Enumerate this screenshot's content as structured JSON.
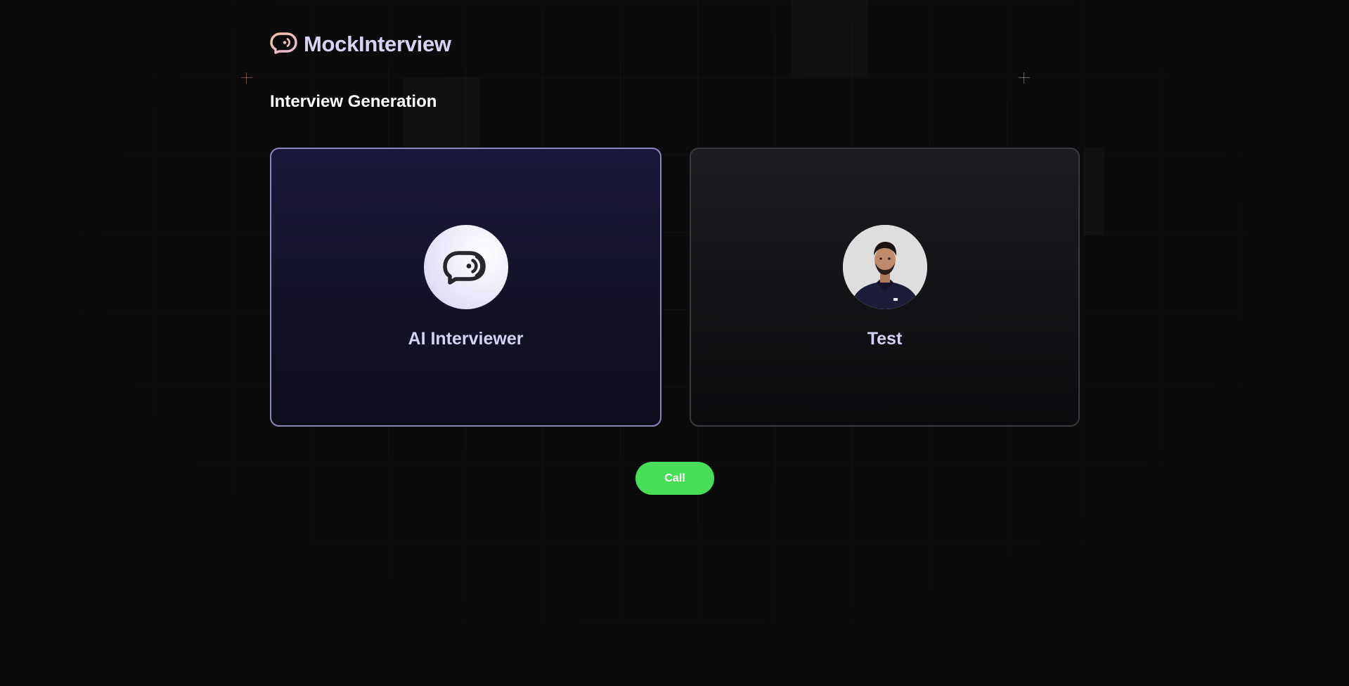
{
  "brand": {
    "name": "MockInterview",
    "icon": "chat-bubble-audio-icon",
    "icon_color": "#f4b99a"
  },
  "page": {
    "title": "Interview Generation"
  },
  "interviewers": [
    {
      "label": "AI Interviewer",
      "avatar": "chat-bubble-audio-icon",
      "selected": true
    },
    {
      "label": "Test",
      "avatar": "user-photo",
      "selected": false
    }
  ],
  "actions": {
    "call_label": "Call"
  },
  "colors": {
    "background": "#0b0b0c",
    "accent": "#d6d3f5",
    "selected_border": "#8a86b8",
    "call_button": "#49de57"
  }
}
